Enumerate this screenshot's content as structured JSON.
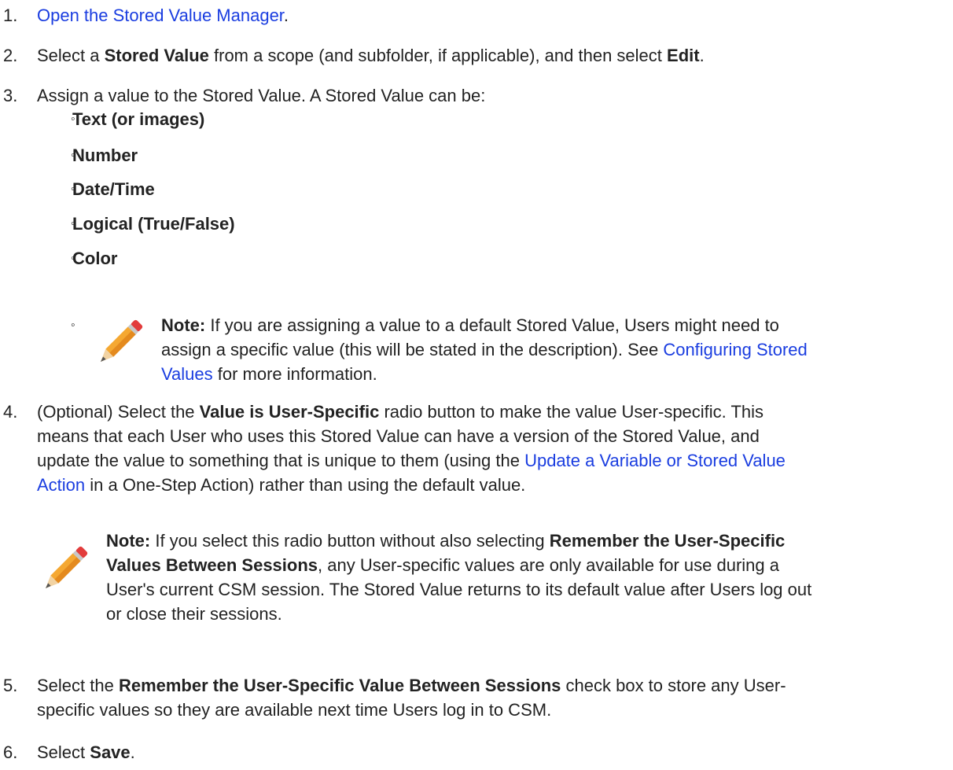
{
  "steps": [
    {
      "number": "1.",
      "link": "Open the Stored Value Manager",
      "after": "."
    },
    {
      "number": "2.",
      "t1": "Select a ",
      "b1": "Stored Value",
      "t2": " from a scope (and subfolder, if applicable), and then select ",
      "b2": "Edit",
      "t3": "."
    },
    {
      "number": "3.",
      "text": "Assign a value to the Stored Value. A Stored Value can be:",
      "types": [
        "Text (or images)",
        "Number",
        "Date/Time",
        "Logical (True/False)",
        "Color"
      ],
      "note": {
        "label": "Note:",
        "l1": " If you are assigning a value to a default Stored Value, Users might need to",
        "l2a": "assign a specific value (this will be stated in the description). See ",
        "link1": "Configuring Stored",
        "link2": "Values",
        "l3": " for more information."
      }
    },
    {
      "number": "4.",
      "l1a": "(Optional) Select the ",
      "l1b": "Value is User-Specific",
      "l1c": " radio button to make the value User-specific. This",
      "l2": "means that each User who uses this Stored Value can have a version of the Stored Value, and",
      "l3a": "update the value to something that is unique to them (using the ",
      "link1": "Update a Variable or Stored Value",
      "link2": "Action",
      "l4": " in a One-Step Action) rather than using the default value.",
      "note": {
        "label": "Note:",
        "l1a": " If you select this radio button without also selecting ",
        "l1b": "Remember the User-Specific",
        "l2a": "Values Between Sessions",
        "l2b": ", any User-specific values are only available for use during a",
        "l3": "User's current CSM session. The Stored Value returns to its default value after Users log out",
        "l4": "or close their sessions."
      }
    },
    {
      "number": "5.",
      "l1a": "Select the ",
      "l1b": "Remember the User-Specific Value Between Sessions",
      "l1c": " check box to store any User-",
      "l2": "specific values so they are available next time Users log in to CSM."
    },
    {
      "number": "6.",
      "t1": "Select ",
      "b1": "Save",
      "t2": "."
    }
  ],
  "bullet_glyph": "◦",
  "icons": {
    "note_icon": "pencil-icon"
  }
}
